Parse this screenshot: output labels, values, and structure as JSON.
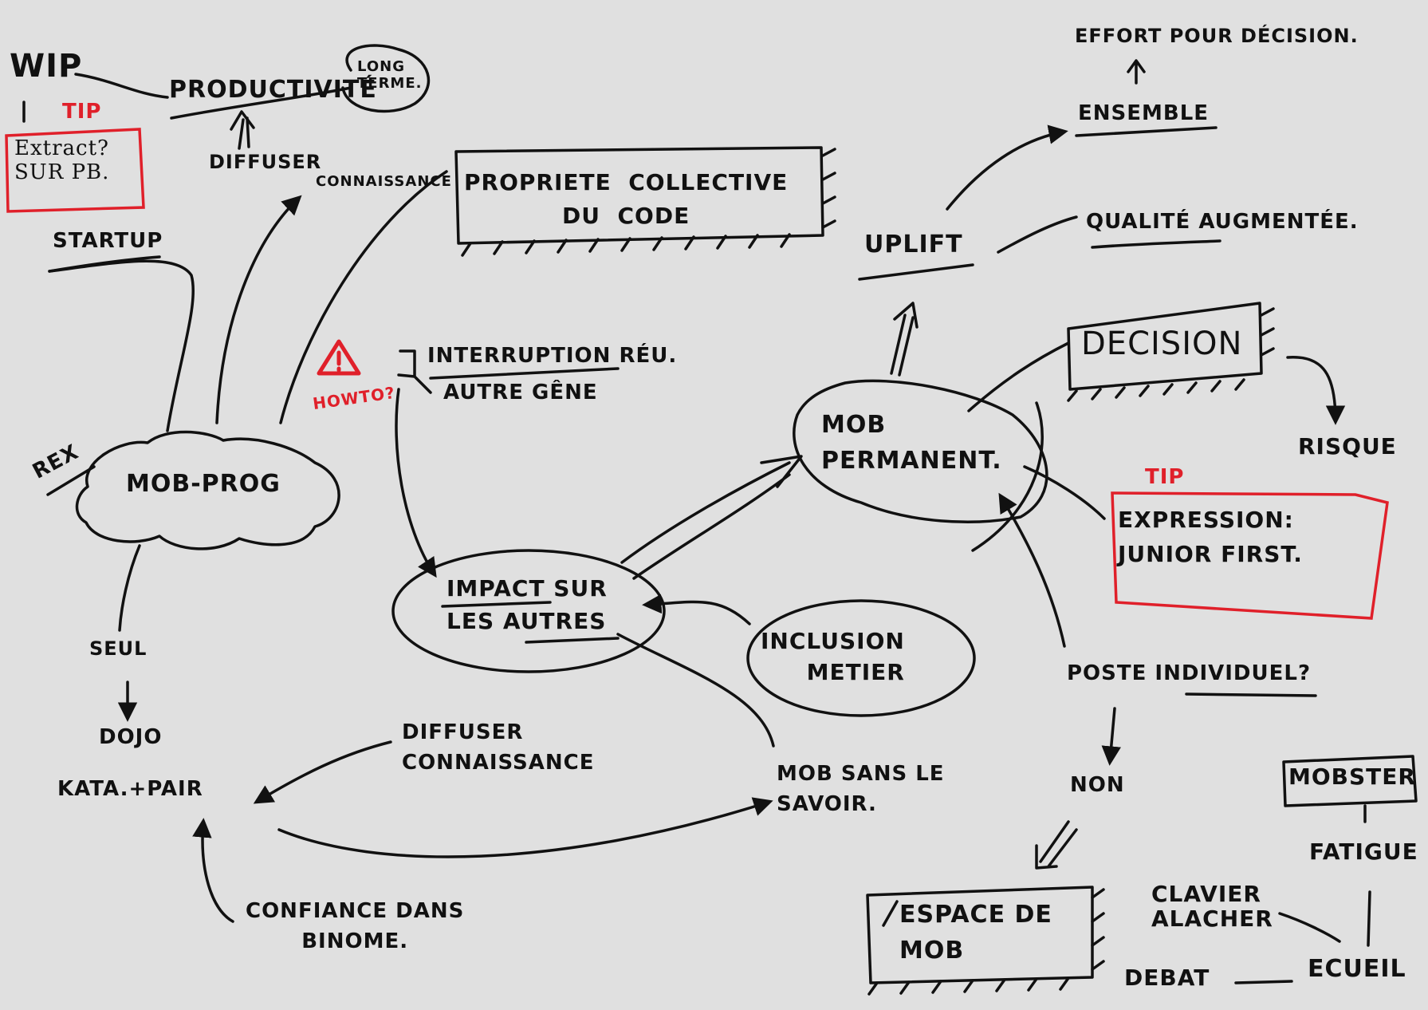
{
  "colors": {
    "ink": "#111111",
    "tip": "#e0202a",
    "paper": "#e0e0e0"
  },
  "icons": {
    "warning": "warning-triangle-icon"
  },
  "nodes": {
    "wip": "WIP",
    "productivite": "PRODUCTIVITÉ",
    "long_terme": "LONG\nTERME.",
    "tip_left": "TIP",
    "extract": "Extract?\nSUR PB.",
    "diffuser_top": "DIFFUSER",
    "connaissance_top": "CONNAISSANCE",
    "propriete": "PROPRIETE  COLLECTIVE\nDU  CODE",
    "startup": "STARTUP",
    "rex": "REX",
    "mob_prog": "MOB-PROG",
    "seul": "SEUL",
    "dojo": "DOJO",
    "kata_pair": "KATA.+PAIR",
    "confiance": "CONFIANCE DANS\nBINOME.",
    "diffuser_bottom": "DIFFUSER\nCONNAISSANCE",
    "howto": "HOWTO?",
    "interruption": "INTERRUPTION RÉU.",
    "autre_gene": "AUTRE GÊNE",
    "impact": "IMPACT SUR\nLES AUTRES",
    "inclusion": "INCLUSION\nMETIER",
    "mob_sans": "MOB SANS LE\nSAVOIR.",
    "mob_permanent": "MOB\nPERMANENT.",
    "uplift": "UPLIFT",
    "effort": "EFFORT POUR DÉCISION.",
    "ensemble": "ENSEMBLE",
    "qualite": "QUALITÉ AUGMENTÉE.",
    "decision": "DECISION",
    "risque": "RISQUE",
    "tip_right": "TIP",
    "expression": "EXPRESSION:\nJUNIOR FIRST.",
    "poste": "POSTE INDIVIDUEL?",
    "non": "NON",
    "espace": "ESPACE DE\nMOB",
    "mobster": "MOBSTER",
    "fatigue": "FATIGUE",
    "clavier": "CLAVIER\nALACHER",
    "debat": "DEBAT",
    "ecueil": "ECUEIL"
  }
}
